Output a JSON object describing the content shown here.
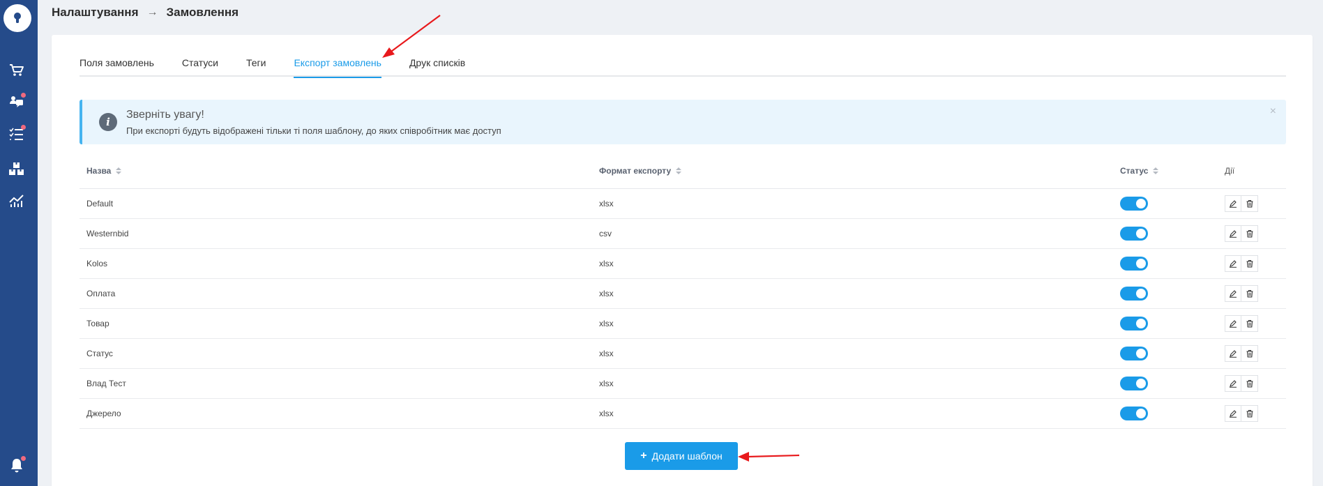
{
  "sidebar": {
    "logo_icon": "keyhole-icon",
    "items": [
      {
        "icon": "cart-icon",
        "badge": false
      },
      {
        "icon": "chat-users-icon",
        "badge": true
      },
      {
        "icon": "checklist-icon",
        "badge": true
      },
      {
        "icon": "boxes-icon",
        "badge": false
      },
      {
        "icon": "analytics-icon",
        "badge": false
      }
    ],
    "bottom_icon": "bell-icon",
    "bottom_badge": true,
    "badge_color": "#f06a7f"
  },
  "breadcrumb": {
    "parent": "Налаштування",
    "separator": "→",
    "current": "Замовлення"
  },
  "tabs": [
    {
      "label": "Поля замовлень",
      "active": false
    },
    {
      "label": "Статуси",
      "active": false
    },
    {
      "label": "Теги",
      "active": false
    },
    {
      "label": "Експорт замовлень",
      "active": true
    },
    {
      "label": "Друк списків",
      "active": false
    }
  ],
  "notice": {
    "title": "Зверніть увагу!",
    "text": "При експорті будуть відображені тільки ті поля шаблону, до яких співробітник має доступ",
    "close": "×"
  },
  "table": {
    "headers": {
      "name": "Назва",
      "format": "Формат експорту",
      "status": "Статус",
      "actions": "Дії"
    },
    "rows": [
      {
        "name": "Default",
        "format": "xlsx",
        "enabled": true
      },
      {
        "name": "Westernbid",
        "format": "csv",
        "enabled": true
      },
      {
        "name": "Kolos",
        "format": "xlsx",
        "enabled": true
      },
      {
        "name": "Оплата",
        "format": "xlsx",
        "enabled": true
      },
      {
        "name": "Товар",
        "format": "xlsx",
        "enabled": true
      },
      {
        "name": "Статус",
        "format": "xlsx",
        "enabled": true
      },
      {
        "name": "Влад Тест",
        "format": "xlsx",
        "enabled": true
      },
      {
        "name": "Джерело",
        "format": "xlsx",
        "enabled": true
      }
    ]
  },
  "add_button": {
    "label": "Додати шаблон",
    "icon": "plus-icon"
  },
  "colors": {
    "accent": "#1a9be8",
    "sidebar": "#254b8a",
    "annotation": "#e8191c"
  }
}
